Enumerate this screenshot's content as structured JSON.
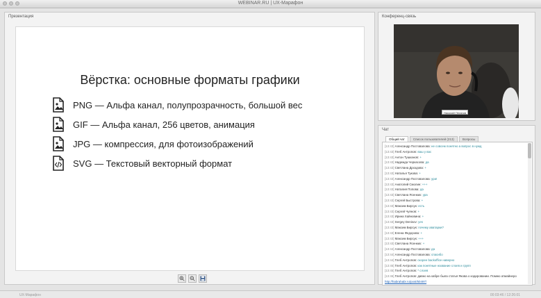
{
  "window": {
    "title": "WEBINAR.RU | UX-Марафон"
  },
  "presentation": {
    "label": "Презентация",
    "slide_title": "Вёрстка: основные форматы графики",
    "bullets": [
      {
        "icon": "image-file-icon",
        "text": "PNG — Альфа канал, полупрозрачность, большой вес"
      },
      {
        "icon": "image-file-icon",
        "text": "GIF — Альфа канал, 256 цветов, анимация"
      },
      {
        "icon": "image-file-icon",
        "text": "JPG — компрессия, для фотоизображений"
      },
      {
        "icon": "code-file-icon",
        "text": "SVG — Текстовый векторный формат"
      }
    ],
    "toolbar_icons": [
      "zoom-in-icon",
      "zoom-out-icon",
      "save-icon"
    ]
  },
  "conference": {
    "label": "Конференц-связь",
    "badge": "Николай Пеганов"
  },
  "chat": {
    "label": "Чат",
    "tabs": [
      "Общий чат",
      "Список пользователей (213)",
      "Вопросы"
    ],
    "messages": [
      {
        "time": "[13:43]",
        "name": "Александр Постовалова:",
        "text": "не совсем понятно а вопрос в нужд"
      },
      {
        "time": "[13:43]",
        "name": "Глеб Антропов:",
        "text": "ваш у вас"
      },
      {
        "time": "[13:43]",
        "name": "Антон Тушканов:",
        "text": "+"
      },
      {
        "time": "[13:43]",
        "name": "Надежда Черкасова:",
        "text": "да"
      },
      {
        "time": "[13:43]",
        "name": "Светлана Дроздова:",
        "text": "+"
      },
      {
        "time": "[13:43]",
        "name": "Наталья Тукова:",
        "text": "+"
      },
      {
        "time": "[13:43]",
        "name": "Александр Постовалова:",
        "text": "ура!"
      },
      {
        "time": "[13:43]",
        "name": "Анатолий Смолин:",
        "text": "+++"
      },
      {
        "time": "[13:43]",
        "name": "Наталия Попова:",
        "text": "да"
      },
      {
        "time": "[13:43]",
        "name": "Светлана Ясенких:",
        "text": "ура"
      },
      {
        "time": "[13:43]",
        "name": "Сергей Быстрова:",
        "text": "+"
      },
      {
        "time": "[13:43]",
        "name": "Максим Бирсук:",
        "text": "есть"
      },
      {
        "time": "[13:43]",
        "name": "Сергей Чуянов:",
        "text": "+"
      },
      {
        "time": "[13:43]",
        "name": "Ирина Хайновина:",
        "text": "+"
      },
      {
        "time": "[13:43]",
        "name": "Sergey Denisov:",
        "text": "yes"
      },
      {
        "time": "[13:43]",
        "name": "Максим Бирсук:",
        "text": "почему аватарки?"
      },
      {
        "time": "[13:43]",
        "name": "Елена Федорова:",
        "text": "+"
      },
      {
        "time": "[13:43]",
        "name": "Максим Бирсук:",
        "text": "+++"
      },
      {
        "time": "[13:43]",
        "name": "Светлана Ясенких:",
        "text": "+"
      },
      {
        "time": "[13:44]",
        "name": "Александр Постовалова:",
        "text": "да"
      },
      {
        "time": "[13:44]",
        "name": "Александр Постовалова:",
        "text": "спасибо"
      },
      {
        "time": "[13:44]",
        "name": "Глеб Антропов:",
        "text": "скорее backoffice наверно"
      },
      {
        "time": "[13:45]",
        "name": "Глеб Антропов:",
        "text": "как понятные название слоев и групп"
      },
      {
        "time": "[13:45]",
        "name": "Глеб Антропов:",
        "text": "* слоев"
      },
      {
        "time": "[13:46]",
        "name": "Глеб Антропов:",
        "text": "давно на хабре была статья Якова о кодировании. Помню атмайнеро"
      },
      {
        "time": "",
        "name": "",
        "text": "http://habrahabr.ru/post/50497/"
      }
    ]
  },
  "status": {
    "left": "UX-Марафон",
    "right": "00:03:46 / 12:26:01"
  }
}
